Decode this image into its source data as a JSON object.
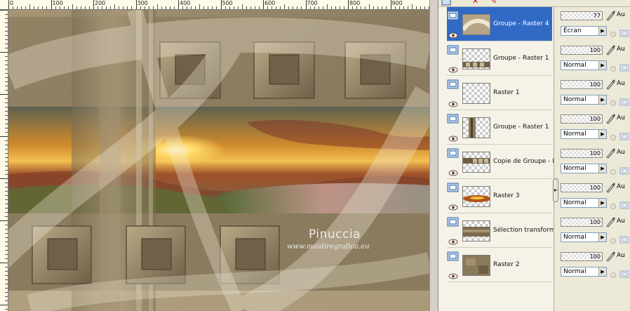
{
  "ruler": {
    "labels": [
      "0",
      "100",
      "200",
      "300",
      "400",
      "500",
      "600",
      "700",
      "800",
      "900"
    ]
  },
  "canvas": {
    "watermark_title": "Pinuccia",
    "watermark_url": "www.maidiregrafica.eu"
  },
  "toolbar": {
    "icons": [
      "new-layer-icon",
      "delete-layer-icon",
      "brush-icon"
    ]
  },
  "layers": [
    {
      "name": "Groupe - Raster 4",
      "selected": true,
      "opacity": 77,
      "blend": "Écran",
      "auto": "Au",
      "thumb": "swirl"
    },
    {
      "name": "Groupe - Raster 1",
      "selected": false,
      "opacity": 100,
      "blend": "Normal",
      "auto": "Au",
      "thumb": "squares-row"
    },
    {
      "name": "Raster 1",
      "selected": false,
      "opacity": 100,
      "blend": "Normal",
      "auto": "Au",
      "thumb": "empty"
    },
    {
      "name": "Groupe - Raster 1",
      "selected": false,
      "opacity": 100,
      "blend": "Normal",
      "auto": "Au",
      "thumb": "vbar"
    },
    {
      "name": "Copie de Groupe - R",
      "selected": false,
      "opacity": 100,
      "blend": "Normal",
      "auto": "Au",
      "thumb": "squares-row-small"
    },
    {
      "name": "Raster 3",
      "selected": false,
      "opacity": 100,
      "blend": "Normal",
      "auto": "Au",
      "thumb": "sunset-strip"
    },
    {
      "name": "Sélection transformé",
      "selected": false,
      "opacity": 100,
      "blend": "Normal",
      "auto": "Au",
      "thumb": "brown-band"
    },
    {
      "name": "Raster 2",
      "selected": false,
      "opacity": 100,
      "blend": "Normal",
      "auto": "Au",
      "thumb": "texture"
    }
  ],
  "colors": {
    "selection": "#316ac5",
    "panel": "#ece9d8"
  }
}
